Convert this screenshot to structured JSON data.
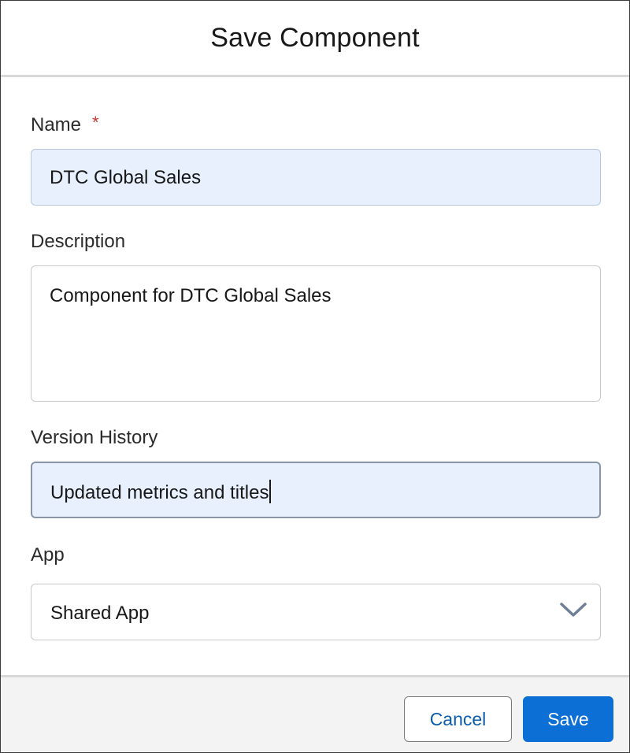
{
  "dialog": {
    "title": "Save Component"
  },
  "form": {
    "name": {
      "label": "Name",
      "required_marker": "*",
      "value": "DTC Global Sales"
    },
    "description": {
      "label": "Description",
      "value": "Component for DTC Global Sales"
    },
    "version_history": {
      "label": "Version History",
      "value": "Updated metrics and titles"
    },
    "app": {
      "label": "App",
      "selected": "Shared App",
      "icon": "chevron-down-icon"
    }
  },
  "footer": {
    "cancel_label": "Cancel",
    "save_label": "Save"
  },
  "colors": {
    "brand_button": "#0b6fd6",
    "link_text": "#0b5cab",
    "required": "#c23934",
    "autofill_bg": "#e8f0fe"
  }
}
